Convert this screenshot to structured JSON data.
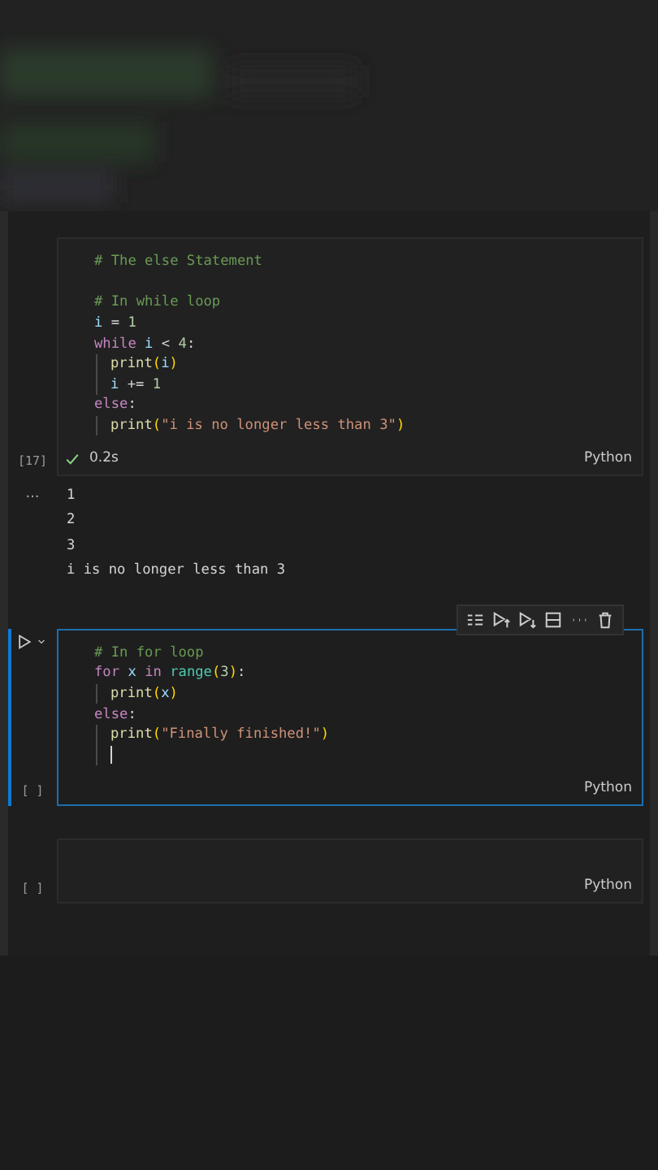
{
  "cells": [
    {
      "selected": false,
      "execution_count": "[17]",
      "status": {
        "success": true,
        "time": "0.2s"
      },
      "language": "Python",
      "lines": [
        {
          "guide": false,
          "caret": false,
          "tokens": [
            {
              "kind": "comment",
              "text": "# The else Statement"
            }
          ]
        },
        {
          "guide": false,
          "caret": false
        },
        {
          "guide": false,
          "caret": false,
          "tokens": [
            {
              "kind": "comment",
              "text": "# In while loop"
            }
          ]
        },
        {
          "guide": false,
          "caret": false,
          "tokens": [
            {
              "kind": "var",
              "text": "i"
            },
            {
              "kind": "plain",
              "text": " = "
            },
            {
              "kind": "num",
              "text": "1"
            }
          ]
        },
        {
          "guide": false,
          "caret": false,
          "tokens": [
            {
              "kind": "keyword",
              "text": "while"
            },
            {
              "kind": "var",
              "text": " i"
            },
            {
              "kind": "plain",
              "text": " < "
            },
            {
              "kind": "num",
              "text": "4"
            },
            {
              "kind": "plain",
              "text": ":"
            }
          ]
        },
        {
          "guide": true,
          "caret": false,
          "tokens": [
            {
              "kind": "func",
              "text": "print"
            },
            {
              "kind": "paren",
              "text": "("
            },
            {
              "kind": "var",
              "text": "i"
            },
            {
              "kind": "paren",
              "text": ")"
            }
          ]
        },
        {
          "guide": true,
          "caret": false,
          "tokens": [
            {
              "kind": "var",
              "text": "i"
            },
            {
              "kind": "plain",
              "text": " += "
            },
            {
              "kind": "num",
              "text": "1"
            }
          ]
        },
        {
          "guide": false,
          "caret": false,
          "tokens": [
            {
              "kind": "keyword",
              "text": "else"
            },
            {
              "kind": "plain",
              "text": ":"
            }
          ]
        },
        {
          "guide": true,
          "caret": false,
          "tokens": [
            {
              "kind": "func",
              "text": "print"
            },
            {
              "kind": "paren",
              "text": "("
            },
            {
              "kind": "string",
              "text": "\"i is no longer less than 3\""
            },
            {
              "kind": "paren",
              "text": ")"
            }
          ]
        }
      ],
      "output_marker": "...",
      "outputs": [
        "1",
        "2",
        "3",
        "i is no longer less than 3"
      ]
    },
    {
      "selected": true,
      "execution_count": "[ ]",
      "language": "Python",
      "lines": [
        {
          "guide": false,
          "caret": false,
          "tokens": [
            {
              "kind": "comment",
              "text": "# In for loop"
            }
          ]
        },
        {
          "guide": false,
          "caret": false,
          "tokens": [
            {
              "kind": "keyword",
              "text": "for"
            },
            {
              "kind": "var",
              "text": " x"
            },
            {
              "kind": "keyword",
              "text": " in"
            },
            {
              "kind": "type",
              "text": " range"
            },
            {
              "kind": "paren",
              "text": "("
            },
            {
              "kind": "num",
              "text": "3"
            },
            {
              "kind": "paren",
              "text": ")"
            },
            {
              "kind": "plain",
              "text": ":"
            }
          ]
        },
        {
          "guide": true,
          "caret": false,
          "tokens": [
            {
              "kind": "func",
              "text": "print"
            },
            {
              "kind": "paren",
              "text": "("
            },
            {
              "kind": "var",
              "text": "x"
            },
            {
              "kind": "paren",
              "text": ")"
            }
          ]
        },
        {
          "guide": false,
          "caret": false,
          "tokens": [
            {
              "kind": "keyword",
              "text": "else"
            },
            {
              "kind": "plain",
              "text": ":"
            }
          ]
        },
        {
          "guide": true,
          "caret": false,
          "tokens": [
            {
              "kind": "func",
              "text": "print"
            },
            {
              "kind": "paren",
              "text": "("
            },
            {
              "kind": "string",
              "text": "\"Finally finished!\""
            },
            {
              "kind": "paren",
              "text": ")"
            }
          ]
        },
        {
          "guide": true,
          "caret": true
        }
      ]
    },
    {
      "selected": false,
      "execution_count": "[ ]",
      "language": "Python"
    }
  ]
}
